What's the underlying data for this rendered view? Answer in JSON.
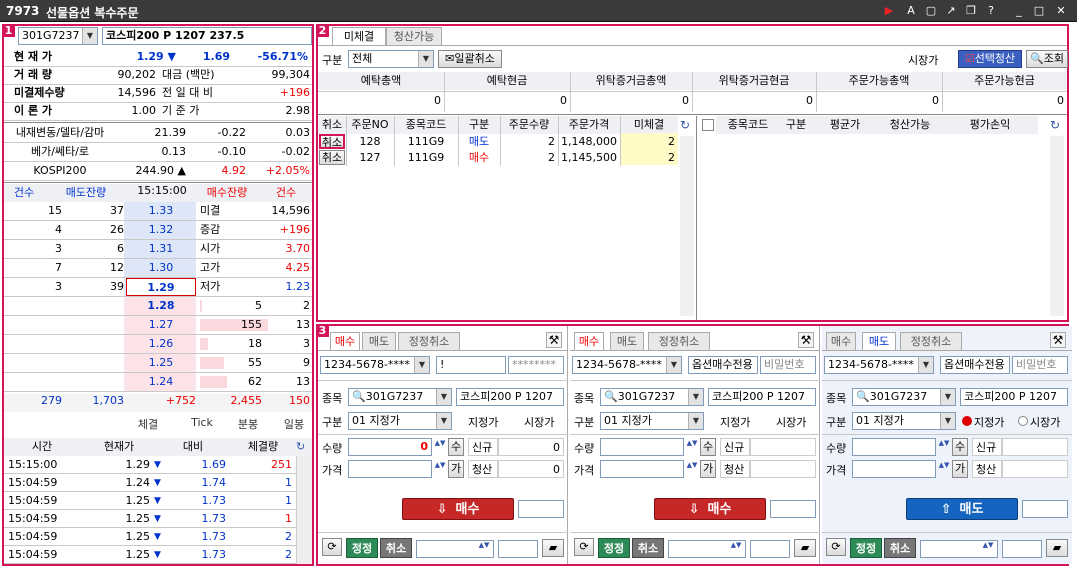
{
  "window": {
    "code": "7973",
    "title": "선물옵션 복수주문"
  },
  "left": {
    "code": "301G7237",
    "name": "코스피200 P 1207 237.5",
    "price_rows": [
      {
        "l": "현 재 가",
        "v1": "1.29 ▼",
        "v2": "1.69",
        "v3": "-56.71%"
      },
      {
        "l": "거 래 량",
        "v1": "90,202",
        "m": "대금 (백만)",
        "v3": "99,304"
      },
      {
        "l": "미결제수량",
        "v1": "14,596",
        "m": "전 일 대 비",
        "v3": "+196"
      },
      {
        "l": "이 론 가",
        "v1": "1.00",
        "m": "기 준 가",
        "v3": "2.98"
      }
    ],
    "greek_rows": [
      {
        "l": "내재변동/델타/감마",
        "a": "21.39",
        "b": "-0.22",
        "c": "0.03"
      },
      {
        "l": "베가/쎄타/로",
        "a": "0.13",
        "b": "-0.10",
        "c": "-0.02"
      },
      {
        "l": "KOSPI200",
        "a": "244.90 ▲",
        "b": "4.92",
        "c": "+2.05%"
      }
    ],
    "hoga_head": [
      "건수",
      "매도잔량",
      "15:15:00",
      "매수잔량",
      "건수"
    ],
    "sell": [
      {
        "cnt": "15",
        "qty": "37",
        "p": "1.33",
        "lbl": "미결",
        "val": "14,596"
      },
      {
        "cnt": "4",
        "qty": "26",
        "p": "1.32",
        "lbl": "증감",
        "val": "+196"
      },
      {
        "cnt": "3",
        "qty": "6",
        "p": "1.31",
        "lbl": "시가",
        "val": "3.70"
      },
      {
        "cnt": "7",
        "qty": "12",
        "p": "1.30",
        "lbl": "고가",
        "val": "4.25"
      },
      {
        "cnt": "3",
        "qty": "39",
        "p": "1.29",
        "lbl": "저가",
        "val": "1.23"
      }
    ],
    "buy": [
      {
        "p": "1.28",
        "qty": "5",
        "cnt": "2"
      },
      {
        "p": "1.27",
        "qty": "155",
        "cnt": "13"
      },
      {
        "p": "1.26",
        "qty": "18",
        "cnt": "3"
      },
      {
        "p": "1.25",
        "qty": "55",
        "cnt": "9"
      },
      {
        "p": "1.24",
        "qty": "62",
        "cnt": "13"
      }
    ],
    "totals": [
      "279",
      "1,703",
      "+752",
      "2,455",
      "150"
    ],
    "subtabs": [
      "체결",
      "Tick",
      "분봉",
      "일봉"
    ],
    "trade_head": [
      "시간",
      "현재가",
      "대비",
      "체결량"
    ],
    "trades": [
      {
        "t": "15:15:00",
        "p": "1.29",
        "d": "1.69",
        "q": "251",
        "qc": "red"
      },
      {
        "t": "15:04:59",
        "p": "1.24",
        "d": "1.74",
        "q": "1",
        "qc": "blue"
      },
      {
        "t": "15:04:59",
        "p": "1.25",
        "d": "1.73",
        "q": "1",
        "qc": "blue"
      },
      {
        "t": "15:04:59",
        "p": "1.25",
        "d": "1.73",
        "q": "1",
        "qc": "red"
      },
      {
        "t": "15:04:59",
        "p": "1.25",
        "d": "1.73",
        "q": "2",
        "qc": "blue"
      },
      {
        "t": "15:04:59",
        "p": "1.25",
        "d": "1.73",
        "q": "2",
        "qc": "blue"
      }
    ]
  },
  "p2": {
    "tabs": [
      "미체결",
      "청산가능"
    ],
    "gubun": "구분",
    "gubun_val": "전체",
    "cancel_all": "일괄취소",
    "market": "시장가",
    "sel_clear": "선택청산",
    "query": "조회",
    "dep_heads": [
      "예탁총액",
      "예탁현금",
      "위탁증거금총액",
      "위탁증거금현금",
      "주문가능총액",
      "주문가능현금"
    ],
    "dep_vals": [
      "0",
      "0",
      "0",
      "0",
      "0",
      "0"
    ],
    "ord_heads": [
      "취소",
      "주문NO",
      "종목코드",
      "구분",
      "주문수량",
      "주문가격",
      "미체결"
    ],
    "orders": [
      {
        "btn": "취소",
        "no": "128",
        "code": "111G9",
        "side": "매도",
        "qty": "2",
        "price": "1,148,000",
        "rem": "2",
        "sc": "blue"
      },
      {
        "btn": "취소",
        "no": "127",
        "code": "111G9",
        "side": "매수",
        "qty": "2",
        "price": "1,145,500",
        "rem": "2",
        "sc": "red"
      }
    ],
    "pos_heads": [
      "종목코드",
      "구분",
      "평균가",
      "청산가능",
      "평가손익"
    ]
  },
  "orders3": [
    {
      "tabs": [
        "매수",
        "매도",
        "정정취소"
      ],
      "active": 0,
      "acct": "1234-5678-****",
      "pw1": "!",
      "pw2": "********",
      "code": "301G7237",
      "name": "코스피200 P 1207",
      "type": "01 지정가",
      "r1": "지정가",
      "r2": "시장가",
      "qty_l": "수량",
      "qty": "0",
      "price_l": "가격",
      "new_l": "신규",
      "new_v": "0",
      "clr_l": "청산",
      "clr_v": "0",
      "action": "매수",
      "color": "buy"
    },
    {
      "tabs": [
        "매수",
        "매도",
        "정정취소"
      ],
      "active": 0,
      "acct": "1234-5678-****",
      "pw1": "옵션매수전용",
      "pw2": "비밀번호",
      "code": "301G7237",
      "name": "코스피200 P 1207",
      "type": "01 지정가",
      "r1": "지정가",
      "r2": "시장가",
      "qty_l": "수량",
      "qty": "",
      "price_l": "가격",
      "new_l": "신규",
      "new_v": "",
      "clr_l": "청산",
      "clr_v": "",
      "action": "매수",
      "color": "buy"
    },
    {
      "tabs": [
        "매수",
        "매도",
        "정정취소"
      ],
      "active": 1,
      "acct": "1234-5678-****",
      "pw1": "옵션매수전용",
      "pw2": "비밀번호",
      "code": "301G7237",
      "name": "코스피200 P 1207",
      "type": "01 지정가",
      "r1": "지정가",
      "r2": "시장가",
      "qty_l": "수량",
      "qty": "",
      "price_l": "가격",
      "new_l": "신규",
      "new_v": "",
      "clr_l": "청산",
      "clr_v": "",
      "action": "매도",
      "color": "sell"
    }
  ],
  "labels": {
    "jongmok": "종목",
    "gubun": "구분",
    "modify": "정정",
    "cancel": "취소"
  },
  "colors": {
    "accent": "#d4145a",
    "buy": "#c62828",
    "sell": "#1565c0"
  }
}
